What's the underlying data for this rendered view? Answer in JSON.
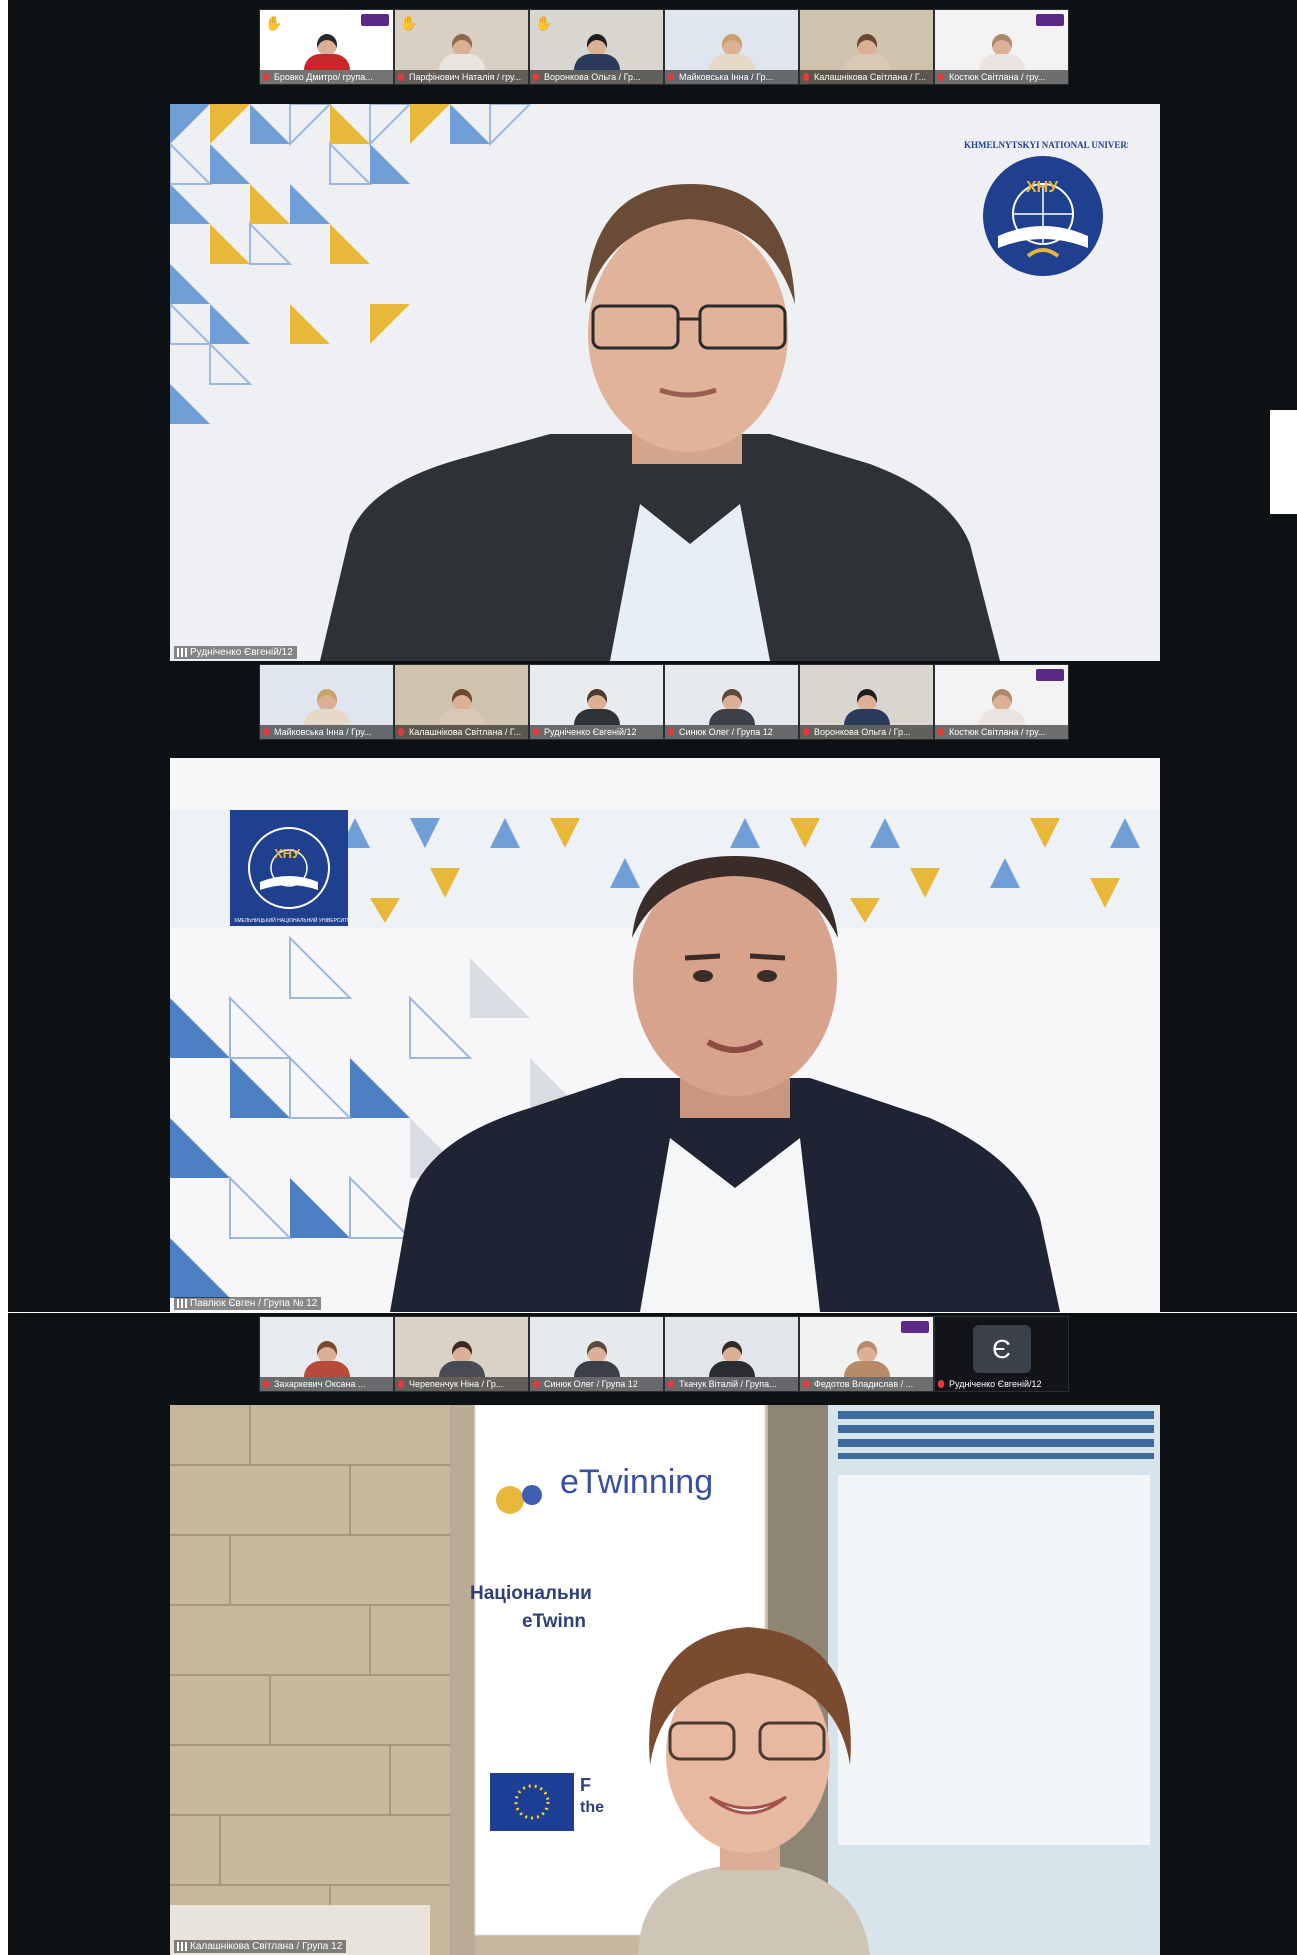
{
  "sections": [
    {
      "thumbs": [
        {
          "name": "Бровко Дмитро/ група...",
          "hand": true,
          "badge": true,
          "bg": "#ffffff",
          "shirt": "#c8262b",
          "hair": "#2a2a2a"
        },
        {
          "name": "Парфінович Наталія / гру...",
          "hand": true,
          "badge": false,
          "bg": "#d9cfc2",
          "shirt": "#e8e4de",
          "hair": "#8a6a4a"
        },
        {
          "name": "Воронкова Ольга / Гр...",
          "hand": true,
          "badge": false,
          "bg": "#d8d6cf",
          "shirt": "#2b3b5c",
          "hair": "#1e1e1e"
        },
        {
          "name": "Майковська Інна / Гр...",
          "hand": false,
          "badge": false,
          "bg": "#dfe6ef",
          "shirt": "#e6d9c8",
          "hair": "#c9a46a"
        },
        {
          "name": "Калашнікова Світлана / Г...",
          "hand": false,
          "badge": false,
          "bg": "#cfc3ae",
          "shirt": "#d8c8b4",
          "hair": "#6b4630"
        },
        {
          "name": "Костюк Світлана / гру...",
          "hand": false,
          "badge": true,
          "bg": "#f3f3f3",
          "shirt": "#e9e4e0",
          "hair": "#a9886b"
        }
      ],
      "video_name": "Рудніченко Євгеній/12",
      "logo_text": "KHMELNYTSKYI NATIONAL UNIVERSITY",
      "logo_abbr": "ХНУ"
    },
    {
      "thumbs": [
        {
          "name": "Майковська Інна / Гру...",
          "hand": false,
          "badge": false,
          "bg": "#dfe6ef",
          "shirt": "#e6d9c8",
          "hair": "#c9a46a"
        },
        {
          "name": "Калашнікова Світлана / Г...",
          "hand": false,
          "badge": false,
          "bg": "#cfc3ae",
          "shirt": "#d8c8b4",
          "hair": "#6b4630"
        },
        {
          "name": "Рудніченко Євгеній/12",
          "hand": false,
          "badge": false,
          "bg": "#e9ecef",
          "shirt": "#2f3338",
          "hair": "#4a3b2e"
        },
        {
          "name": "Синюк Олег / Група 12",
          "hand": false,
          "badge": false,
          "bg": "#e6e9ee",
          "shirt": "#3a3f48",
          "hair": "#5a4a3c"
        },
        {
          "name": "Воронкова Ольга / Гр...",
          "hand": false,
          "badge": false,
          "bg": "#d8d6cf",
          "shirt": "#2b3b5c",
          "hair": "#1e1e1e"
        },
        {
          "name": "Костюк Світлана / гру...",
          "hand": false,
          "badge": true,
          "bg": "#f3f3f3",
          "shirt": "#e9e4e0",
          "hair": "#a9886b"
        }
      ],
      "video_name": "Павлюк Євген / Група № 12",
      "logo_text": "ХМЕЛЬНИЦЬКИЙ НАЦІОНАЛЬНИЙ УНІВЕРСИТЕТ",
      "logo_abbr": "ХНУ"
    },
    {
      "thumbs": [
        {
          "name": "Захаркевич Оксана ...",
          "hand": false,
          "badge": false,
          "bg": "#e7eaee",
          "shirt": "#b74a3a",
          "hair": "#7a4a30"
        },
        {
          "name": "Черепенчук Ніна / Гр...",
          "hand": false,
          "badge": false,
          "bg": "#d9d2c6",
          "shirt": "#4a4a52",
          "hair": "#3a2a22"
        },
        {
          "name": "Синюк Олег / Група 12",
          "hand": false,
          "badge": false,
          "bg": "#e6e9ee",
          "shirt": "#3a3f48",
          "hair": "#5a4a3c"
        },
        {
          "name": "Ткачук Віталій / Група...",
          "hand": false,
          "badge": false,
          "bg": "#e2e5ea",
          "shirt": "#2a2c30",
          "hair": "#2f2a28"
        },
        {
          "name": "Федотов Владислав / ...",
          "hand": false,
          "badge": true,
          "bg": "#f2f2f2",
          "shirt": "#b88a6a",
          "hair": "#b88a6a"
        }
      ],
      "avatar_thumb": {
        "initial": "Є",
        "name": "Рудніченко Євгеній/12"
      },
      "video_name": "Калашнікова Світлана / Група 12",
      "banner_brand": "eTwinning",
      "banner_line1": "Національни",
      "banner_line2": "eTwinn",
      "banner_eu1": "F",
      "banner_eu2": "the"
    }
  ],
  "colors": {
    "stage_bg": "#0e1114",
    "accent_blue": "#1f3f8f",
    "accent_yellow": "#e8b83a",
    "light_blue": "#6f9fd6"
  }
}
